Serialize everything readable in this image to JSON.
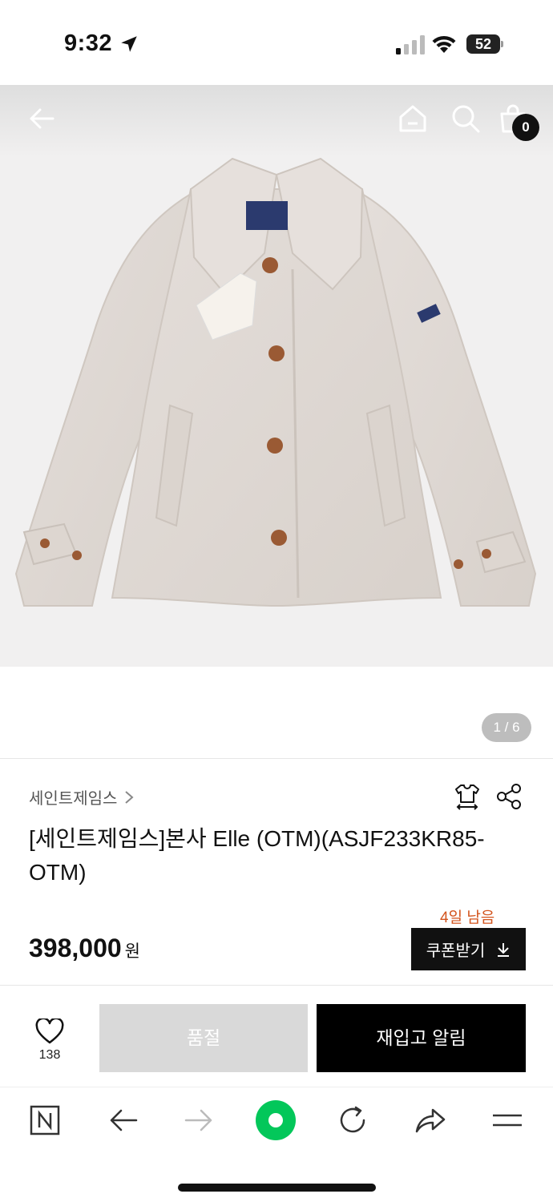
{
  "status_bar": {
    "time": "9:32",
    "battery": "52"
  },
  "header": {
    "cart_count": "0",
    "icons": [
      "back-arrow-icon",
      "home-icon",
      "search-icon",
      "cart-icon"
    ]
  },
  "gallery": {
    "page_indicator": "1 / 6"
  },
  "product": {
    "brand": "세인트제임스",
    "title": "[세인트제임스]본사 Elle (OTM)(ASJF233KR85-OTM)",
    "coupon_deadline": "4일 남음",
    "price": "398,000",
    "currency": "원",
    "coupon_label": "쿠폰받기"
  },
  "actions": {
    "like_count": "138",
    "soldout_label": "품절",
    "restock_label": "재입고 알림"
  },
  "browser_toolbar": {
    "icons": [
      "naver-n-icon",
      "back-icon",
      "forward-icon",
      "green-dot-icon",
      "reload-icon",
      "share-arrow-icon",
      "menu-icon"
    ]
  },
  "colors": {
    "accent_orange": "#d3541d",
    "primary_black": "#000000",
    "disabled_gray": "#d9d9d9",
    "naver_green": "#03c75a"
  }
}
